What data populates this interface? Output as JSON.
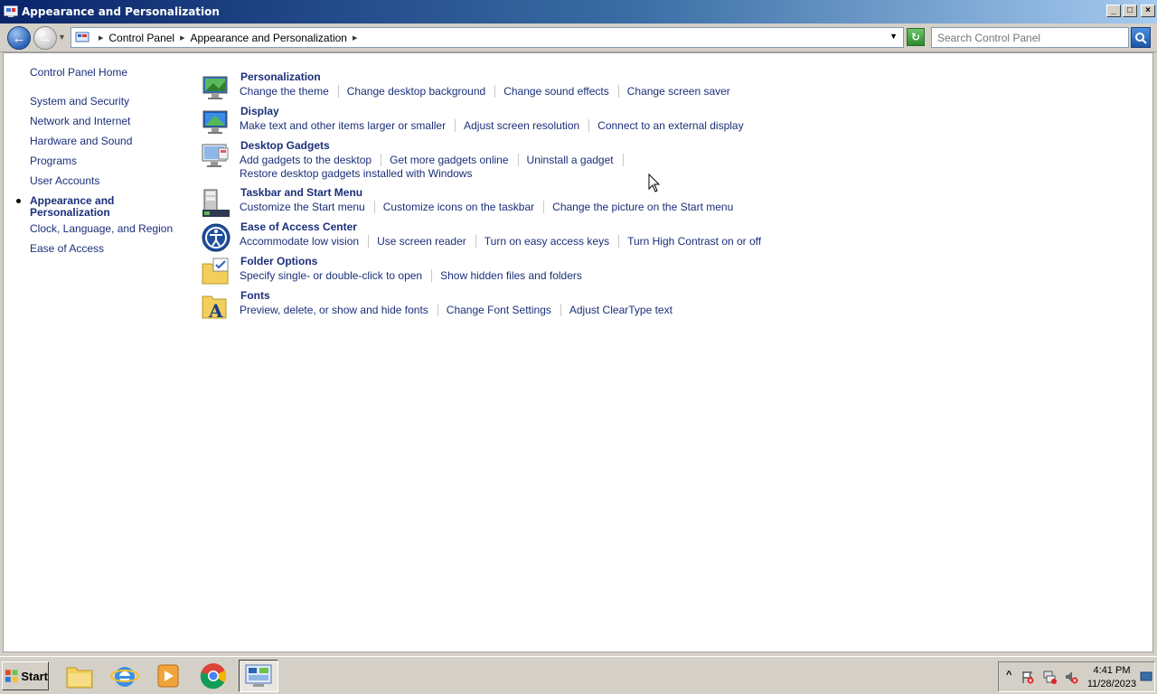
{
  "window": {
    "title": "Appearance and Personalization"
  },
  "navbar": {
    "breadcrumbs": [
      "Control Panel",
      "Appearance and Personalization"
    ],
    "search_placeholder": "Search Control Panel"
  },
  "sidebar": {
    "home": "Control Panel Home",
    "items": [
      "System and Security",
      "Network and Internet",
      "Hardware and Sound",
      "Programs",
      "User Accounts",
      "Appearance and Personalization",
      "Clock, Language, and Region",
      "Ease of Access"
    ],
    "current_index": 5
  },
  "categories": [
    {
      "title": "Personalization",
      "icon": "personalization-icon",
      "links": [
        "Change the theme",
        "Change desktop background",
        "Change sound effects",
        "Change screen saver"
      ]
    },
    {
      "title": "Display",
      "icon": "display-icon",
      "links": [
        "Make text and other items larger or smaller",
        "Adjust screen resolution",
        "Connect to an external display"
      ]
    },
    {
      "title": "Desktop Gadgets",
      "icon": "desktop-gadgets-icon",
      "links": [
        "Add gadgets to the desktop",
        "Get more gadgets online",
        "Uninstall a gadget"
      ],
      "links_line2": [
        "Restore desktop gadgets installed with Windows"
      ]
    },
    {
      "title": "Taskbar and Start Menu",
      "icon": "taskbar-icon",
      "links": [
        "Customize the Start menu",
        "Customize icons on the taskbar",
        "Change the picture on the Start menu"
      ]
    },
    {
      "title": "Ease of Access Center",
      "icon": "ease-of-access-icon",
      "links": [
        "Accommodate low vision",
        "Use screen reader",
        "Turn on easy access keys",
        "Turn High Contrast on or off"
      ]
    },
    {
      "title": "Folder Options",
      "icon": "folder-options-icon",
      "links": [
        "Specify single- or double-click to open",
        "Show hidden files and folders"
      ]
    },
    {
      "title": "Fonts",
      "icon": "fonts-icon",
      "links": [
        "Preview, delete, or show and hide fonts",
        "Change Font Settings",
        "Adjust ClearType text"
      ]
    }
  ],
  "taskbar": {
    "start_label": "Start",
    "apps": [
      "file-explorer-icon",
      "internet-explorer-icon",
      "media-player-icon",
      "chrome-icon",
      "control-panel-icon"
    ],
    "active_app": "control-panel-icon",
    "clock_time": "4:41 PM",
    "clock_date": "11/28/2023"
  },
  "colors": {
    "link": "#1a2f7a",
    "titlebar_start": "#0a246a",
    "titlebar_end": "#a6caf0",
    "chrome_bg": "#d4d0c8"
  }
}
